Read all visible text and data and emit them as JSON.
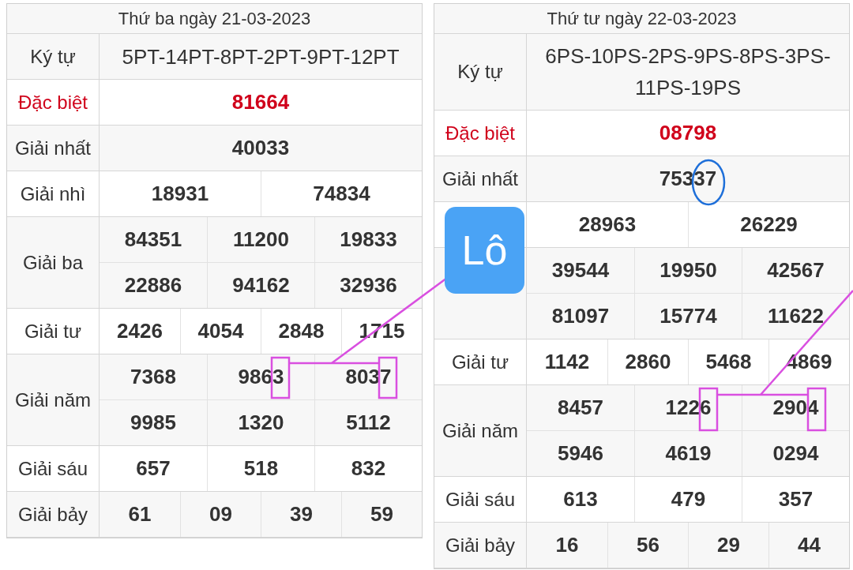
{
  "tables": [
    {
      "title": "Thứ ba ngày 21-03-2023",
      "rows": [
        {
          "label": "Ký tự",
          "kind": "code",
          "lines": [
            [
              "5PT-14PT-8PT-2PT-9PT-12PT"
            ]
          ]
        },
        {
          "label": "Đặc biệt",
          "kind": "special",
          "lines": [
            [
              "81664"
            ]
          ]
        },
        {
          "label": "Giải nhất",
          "kind": "normal",
          "lines": [
            [
              "40033"
            ]
          ]
        },
        {
          "label": "Giải nhì",
          "kind": "normal",
          "lines": [
            [
              "18931",
              "74834"
            ]
          ]
        },
        {
          "label": "Giải ba",
          "kind": "normal",
          "lines": [
            [
              "84351",
              "11200",
              "19833"
            ],
            [
              "22886",
              "94162",
              "32936"
            ]
          ]
        },
        {
          "label": "Giải tư",
          "kind": "normal",
          "lines": [
            [
              "2426",
              "4054",
              "2848",
              "1715"
            ]
          ]
        },
        {
          "label": "Giải năm",
          "kind": "normal",
          "lines": [
            [
              "7368",
              "9863",
              "8037"
            ],
            [
              "9985",
              "1320",
              "5112"
            ]
          ]
        },
        {
          "label": "Giải sáu",
          "kind": "normal",
          "lines": [
            [
              "657",
              "518",
              "832"
            ]
          ]
        },
        {
          "label": "Giải bảy",
          "kind": "normal",
          "lines": [
            [
              "61",
              "09",
              "39",
              "59"
            ]
          ]
        }
      ]
    },
    {
      "title": "Thứ tư ngày 22-03-2023",
      "rows": [
        {
          "label": "Ký tự",
          "kind": "code",
          "lines": [
            [
              "6PS-10PS-2PS-9PS-8PS-3PS-11PS-19PS"
            ]
          ]
        },
        {
          "label": "Đặc biệt",
          "kind": "special",
          "lines": [
            [
              "08798"
            ]
          ]
        },
        {
          "label": "Giải nhất",
          "kind": "normal",
          "lines": [
            [
              "75337"
            ]
          ]
        },
        {
          "kind": "normal",
          "lines": [
            [
              "28963",
              "26229"
            ]
          ]
        },
        {
          "kind": "normal",
          "lines": [
            [
              "39544",
              "19950",
              "42567"
            ],
            [
              "81097",
              "15774",
              "11622"
            ]
          ]
        },
        {
          "label": "Giải tư",
          "kind": "normal",
          "lines": [
            [
              "1142",
              "2860",
              "5468",
              "4869"
            ]
          ]
        },
        {
          "label": "Giải năm",
          "kind": "normal",
          "lines": [
            [
              "8457",
              "1226",
              "2904"
            ],
            [
              "5946",
              "4619",
              "0294"
            ]
          ]
        },
        {
          "label": "Giải sáu",
          "kind": "normal",
          "lines": [
            [
              "613",
              "479",
              "357"
            ]
          ]
        },
        {
          "label": "Giải bảy",
          "kind": "normal",
          "lines": [
            [
              "16",
              "56",
              "29",
              "44"
            ]
          ]
        }
      ]
    }
  ],
  "badge": {
    "text": "Lô"
  }
}
